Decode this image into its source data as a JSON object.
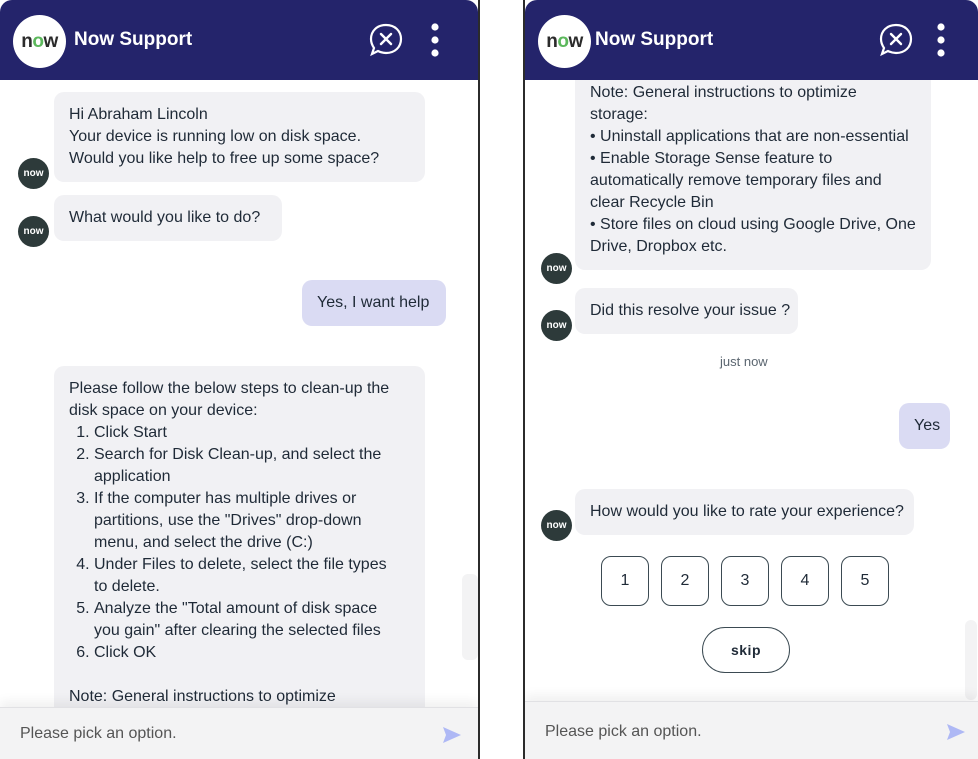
{
  "colors": {
    "header": "#24246b",
    "bot_bubble": "#f1f1f4",
    "user_bubble": "#dadbf3",
    "avatar": "#2d3a3a",
    "accent_o": "#5cb85c"
  },
  "app": {
    "logo_n": "n",
    "logo_o": "o",
    "logo_w": "w",
    "title": "Now Support",
    "avatar_text": "now"
  },
  "icons": {
    "close": "close-chat-icon",
    "menu": "more-vertical-icon",
    "send": "send-icon"
  },
  "left": {
    "greeting": [
      "Hi Abraham Lincoln",
      "Your device is running low on disk space.",
      "Would you like help to free up some space?"
    ],
    "question": "What would you like to do?",
    "user_reply": "Yes, I want help",
    "steps_intro": [
      "Please follow the below steps to clean-up the",
      "disk space on your device:"
    ],
    "steps": [
      [
        "Click Start"
      ],
      [
        "Search for Disk Clean-up, and select the",
        "application"
      ],
      [
        "If the computer has multiple drives or",
        "partitions, use the \"Drives\" drop-down",
        "menu, and select the drive (C:)"
      ],
      [
        "Under Files to delete, select the file types",
        "to delete."
      ],
      [
        "Analyze the \"Total amount of disk space",
        "you gain\" after clearing the selected files"
      ],
      [
        "Click OK"
      ]
    ],
    "note_cut": "Note: General instructions to optimize"
  },
  "right": {
    "note_lines": [
      "Note: General instructions to optimize",
      "storage:",
      "• Uninstall applications that are non-essential",
      "• Enable Storage Sense feature to",
      "automatically remove temporary files and",
      "clear Recycle Bin",
      "• Store files on cloud using Google Drive, One",
      "Drive, Dropbox etc."
    ],
    "resolve_question": "Did this resolve your issue ?",
    "timestamp": "just now",
    "user_reply": "Yes",
    "rate_question": "How would you like to rate your experience?",
    "ratings": [
      "1",
      "2",
      "3",
      "4",
      "5"
    ],
    "skip": "skip"
  },
  "footer": {
    "placeholder": "Please pick an option."
  }
}
